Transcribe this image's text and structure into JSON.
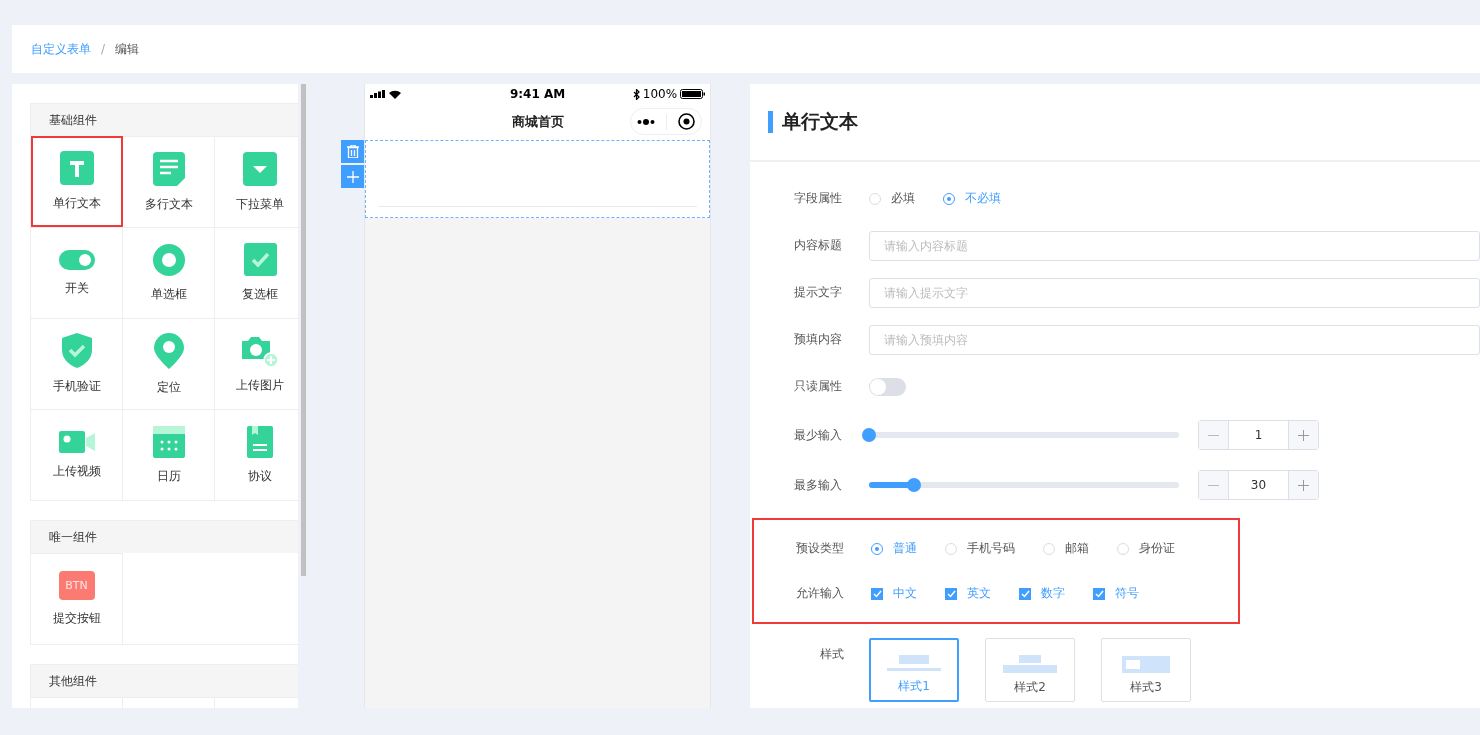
{
  "breadcrumb": [
    {
      "label": "自定义表单",
      "link": true
    },
    {
      "label": "编辑",
      "link": false
    }
  ],
  "breadcrumb_separator": "/",
  "palette": {
    "sections": [
      {
        "title": "基础组件",
        "items": [
          {
            "label": "单行文本",
            "kind": "text",
            "selected": true
          },
          {
            "label": "多行文本",
            "kind": "textarea",
            "selected": false
          },
          {
            "label": "下拉菜单",
            "kind": "dropdown",
            "selected": false
          },
          {
            "label": "开关",
            "kind": "switch",
            "selected": false
          },
          {
            "label": "单选框",
            "kind": "radio",
            "selected": false
          },
          {
            "label": "复选框",
            "kind": "checkbox",
            "selected": false
          },
          {
            "label": "手机验证",
            "kind": "shield",
            "selected": false
          },
          {
            "label": "定位",
            "kind": "location",
            "selected": false
          },
          {
            "label": "上传图片",
            "kind": "camera",
            "selected": false
          },
          {
            "label": "上传视频",
            "kind": "video",
            "selected": false
          },
          {
            "label": "日历",
            "kind": "calendar",
            "selected": false
          },
          {
            "label": "协议",
            "kind": "agreement",
            "selected": false
          }
        ]
      },
      {
        "title": "唯一组件",
        "items": [
          {
            "label": "提交按钮",
            "kind": "button",
            "badge": "BTN",
            "selected": false
          }
        ]
      },
      {
        "title": "其他组件"
      }
    ]
  },
  "phone": {
    "time": "9:41 AM",
    "battery": "100%",
    "title": "商城首页"
  },
  "editor": {
    "title": "单行文本",
    "rows": [
      {
        "kind": "radio",
        "label": "字段属性",
        "options": [
          {
            "label": "必填",
            "selected": false
          },
          {
            "label": "不必填",
            "selected": true
          }
        ]
      },
      {
        "kind": "input",
        "label": "内容标题",
        "placeholder": "请输入内容标题"
      },
      {
        "kind": "input",
        "label": "提示文字",
        "placeholder": "请输入提示文字"
      },
      {
        "kind": "input",
        "label": "预填内容",
        "placeholder": "请输入预填内容"
      },
      {
        "kind": "switch",
        "label": "只读属性",
        "on": false
      },
      {
        "kind": "slider",
        "label": "最少输入",
        "level": 0,
        "value": "1"
      },
      {
        "kind": "slider",
        "label": "最多输入",
        "level": 0.145,
        "value": "30"
      }
    ],
    "highlight_group": {
      "highlighted": true,
      "rows": [
        {
          "kind": "radio",
          "label": "预设类型",
          "options": [
            {
              "label": "普通",
              "selected": true
            },
            {
              "label": "手机号码",
              "selected": false
            },
            {
              "label": "邮箱",
              "selected": false
            },
            {
              "label": "身份证",
              "selected": false
            }
          ]
        },
        {
          "kind": "checkbox",
          "label": "允许输入",
          "options": [
            {
              "label": "中文",
              "checked": true
            },
            {
              "label": "英文",
              "checked": true
            },
            {
              "label": "数字",
              "checked": true
            },
            {
              "label": "符号",
              "checked": true
            }
          ]
        }
      ]
    },
    "style_row": {
      "label": "样式",
      "options": [
        {
          "label": "样式1",
          "kind": "underline",
          "selected": true
        },
        {
          "label": "样式2",
          "kind": "stacked",
          "selected": false
        },
        {
          "label": "样式3",
          "kind": "inline",
          "selected": false
        }
      ]
    }
  }
}
